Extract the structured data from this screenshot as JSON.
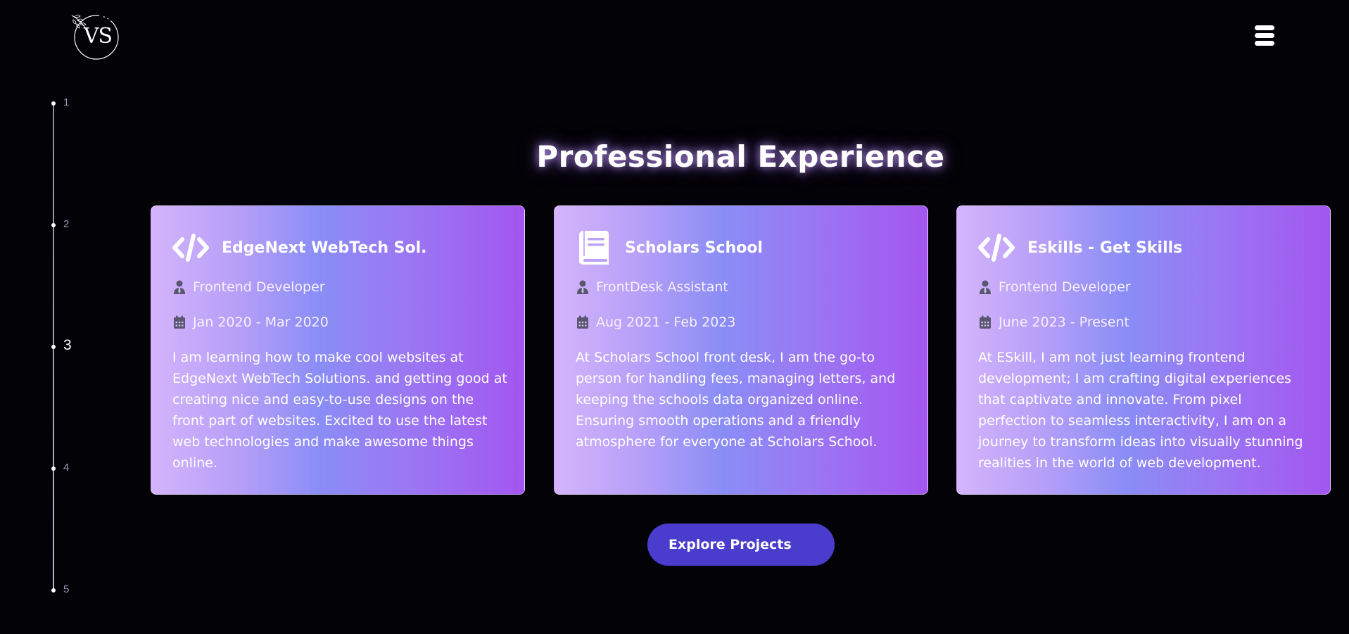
{
  "logo": {
    "text": "VS",
    "icon": "leaf-circle-logo-icon"
  },
  "menu": {
    "icon": "hamburger-menu-icon"
  },
  "side_nav": {
    "items": [
      {
        "label": "1",
        "active": false
      },
      {
        "label": "2",
        "active": false
      },
      {
        "label": "3",
        "active": true
      },
      {
        "label": "4",
        "active": false
      },
      {
        "label": "5",
        "active": false
      }
    ]
  },
  "section": {
    "title": "Professional Experience"
  },
  "cards": [
    {
      "icon": "code-icon",
      "company": "EdgeNext WebTech Sol.",
      "role": "Frontend Developer",
      "dates": "Jan 2020 - Mar 2020",
      "description": "I am learning how to make cool websites at EdgeNext WebTech Solutions. and getting good at creating nice and easy-to-use designs on the front part of websites. Excited to use the latest web technologies and make awesome things online."
    },
    {
      "icon": "book-icon",
      "company": "Scholars School",
      "role": "FrontDesk Assistant",
      "dates": "Aug 2021 - Feb 2023",
      "description": "At Scholars School front desk, I am the go-to person for handling fees, managing letters, and keeping the schools data organized online. Ensuring smooth operations and a friendly atmosphere for everyone at Scholars School."
    },
    {
      "icon": "code-icon",
      "company": "Eskills - Get Skills",
      "role": "Frontend Developer",
      "dates": "June 2023 - Present",
      "description": "At ESkill, I am not just learning frontend development; I am crafting digital experiences that captivate and innovate. From pixel perfection to seamless interactivity, I am on a journey to transform ideas into visually stunning realities in the world of web development."
    }
  ],
  "explore_button": {
    "label": "Explore Projects"
  },
  "colors": {
    "background": "#030206",
    "button": "#4a3ccc",
    "card_gradient": [
      "#d4b4fc",
      "#8a8df6",
      "#a356f0"
    ]
  }
}
